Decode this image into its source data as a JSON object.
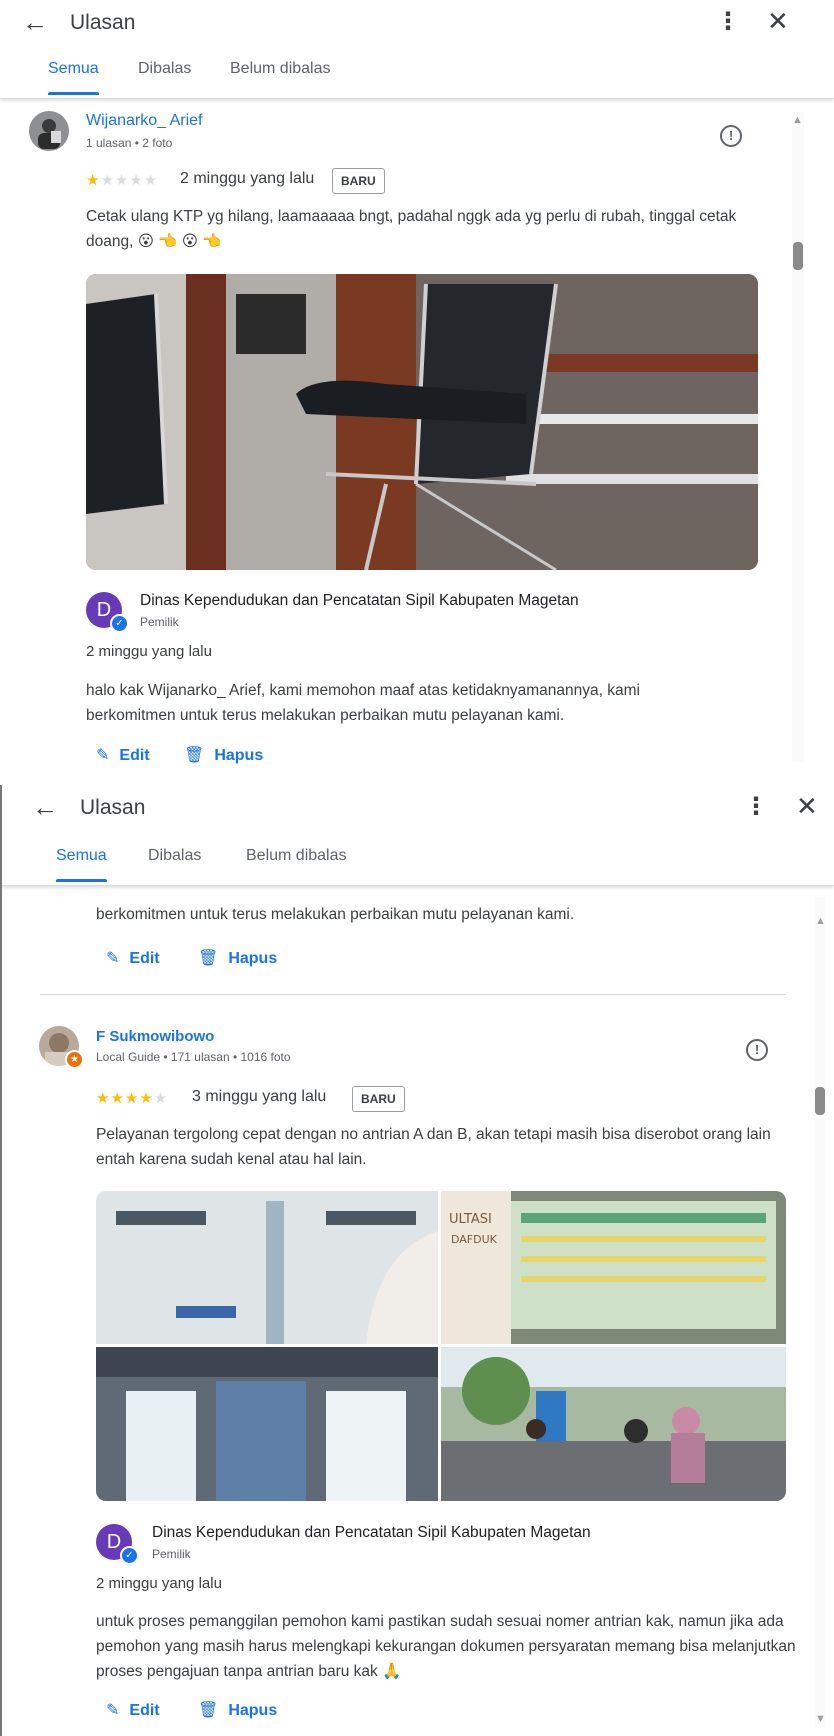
{
  "header": {
    "back_icon": "arrow-left-icon",
    "title": "Ulasan",
    "more_icon": "kebab-icon",
    "close_icon": "close-icon"
  },
  "tabs": [
    {
      "label": "Semua",
      "active": true
    },
    {
      "label": "Dibalas"
    },
    {
      "label": "Belum dibalas"
    }
  ],
  "reviews": [
    {
      "author": "Wijanarko_ Arief",
      "meta": "1 ulasan • 2 foto",
      "rating": 1,
      "time": "2 minggu yang lalu",
      "badge": "BARU",
      "text": "Cetak ulang KTP yg hilang, laamaaaaa bngt, padahal nggk ada yg perlu di rubah, tinggal cetak doang, 😮 👈 😮 👈",
      "reply": {
        "owner": "Dinas Kependudukan dan Pencatatan Sipil Kabupaten Magetan",
        "owner_initial": "D",
        "role": "Pemilik",
        "time": "2 minggu yang lalu",
        "text": "halo kak Wijanarko_ Arief, kami memohon maaf atas ketidaknyamanannya, kami berkomitmen untuk terus melakukan perbaikan mutu pelayanan kami."
      }
    },
    {
      "author": "F Sukmowibowo",
      "meta": "Local Guide • 171 ulasan • 1016 foto",
      "rating": 4,
      "time": "3 minggu yang lalu",
      "badge": "BARU",
      "text": "Pelayanan tergolong cepat dengan no antrian A dan B, akan tetapi masih bisa diserobot orang lain entah karena sudah kenal atau hal lain.",
      "photo_texts": [
        "ULTASI",
        "DAFDUK"
      ],
      "reply": {
        "owner": "Dinas Kependudukan dan Pencatatan Sipil Kabupaten Magetan",
        "owner_initial": "D",
        "role": "Pemilik",
        "time": "2 minggu yang lalu",
        "text": "untuk proses pemanggilan pemohon kami pastikan sudah sesuai nomer antrian kak, namun jika ada pemohon yang masih harus melengkapi kekurangan dokumen persyaratan memang bisa melanjutkan proses pengajuan tanpa antrian baru kak 🙏"
      }
    }
  ],
  "scrolled_text": "berkomitmen untuk terus melakukan perbaikan mutu pelayanan kami.",
  "actions": {
    "edit": "Edit",
    "delete": "Hapus"
  },
  "colors": {
    "accent": "#1a73e8",
    "star": "#fbbc04",
    "owner_avatar": "#673ab7"
  }
}
